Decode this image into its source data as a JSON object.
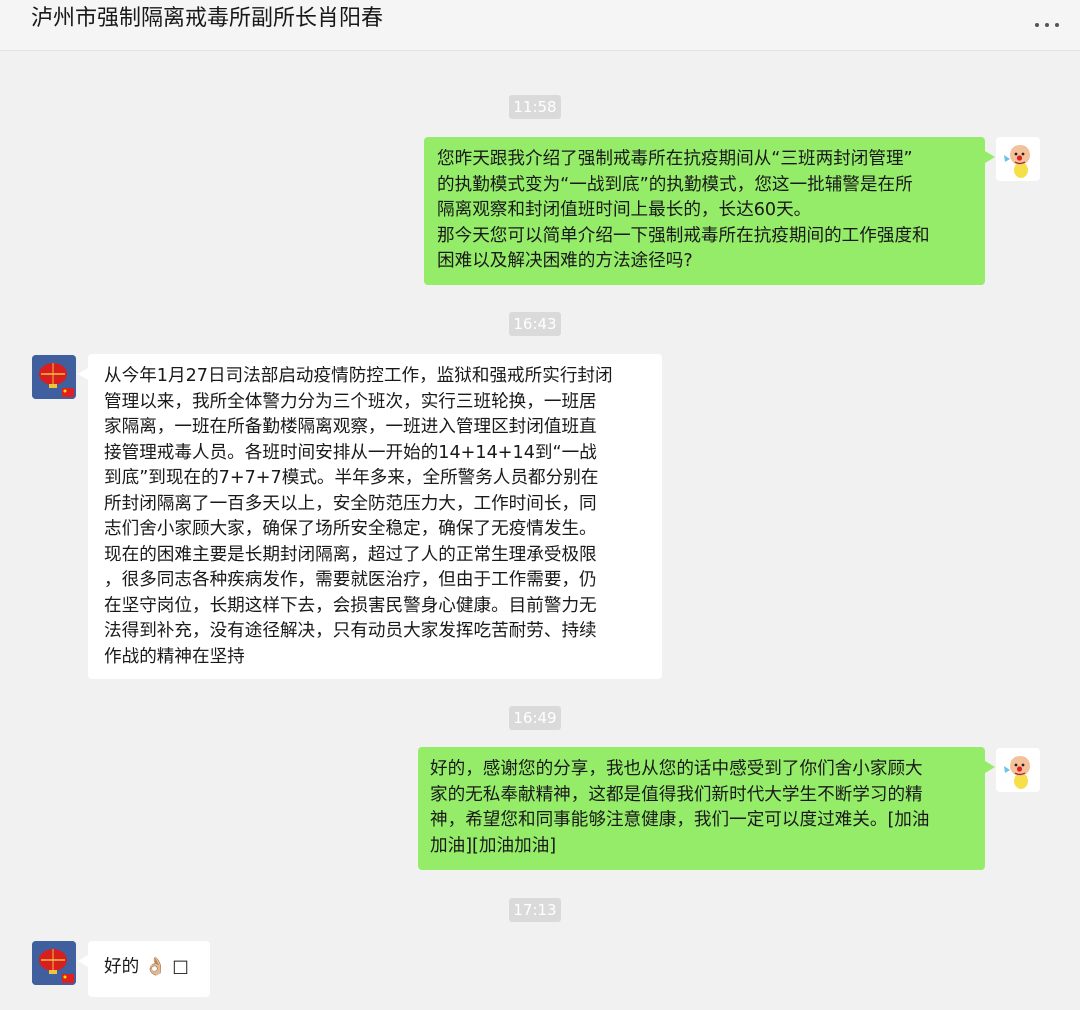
{
  "header": {
    "title": "泸州市强制隔离戒毒所副所长肖阳春",
    "more_icon": "more-icon"
  },
  "messages": [
    {
      "type": "time",
      "text": "11:58"
    },
    {
      "type": "sent",
      "text": "您昨天跟我介绍了强制戒毒所在抗疫期间从“三班两封闭管理”\n的执勤模式变为“一战到底”的执勤模式，您这一批辅警是在所\n隔离观察和封闭值班时间上最长的，长达60天。\n那今天您可以简单介绍一下强制戒毒所在抗疫期间的工作强度和\n困难以及解决困难的方法途径吗?"
    },
    {
      "type": "time",
      "text": "16:43"
    },
    {
      "type": "received",
      "text": "从今年1月27日司法部启动疫情防控工作，监狱和强戒所实行封闭\n管理以来，我所全体警力分为三个班次，实行三班轮换，一班居\n家隔离，一班在所备勤楼隔离观察，一班进入管理区封闭值班直\n接管理戒毒人员。各班时间安排从一开始的14+14+14到“一战\n到底”到现在的7+7+7模式。半年多来，全所警务人员都分别在\n所封闭隔离了一百多天以上，安全防范压力大，工作时间长，同\n志们舍小家顾大家，确保了场所安全稳定，确保了无疫情发生。\n现在的困难主要是长期封闭隔离，超过了人的正常生理承受极限\n，很多同志各种疾病发作，需要就医治疗，但由于工作需要，仍\n在坚守岗位，长期这样下去，会损害民警身心健康。目前警力无\n法得到补充，没有途径解决，只有动员大家发挥吃苦耐劳、持续\n作战的精神在坚持"
    },
    {
      "type": "time",
      "text": "16:49"
    },
    {
      "type": "sent",
      "text": "好的，感谢您的分享，我也从您的话中感受到了你们舍小家顾大\n家的无私奉献精神，这都是值得我们新时代大学生不断学习的精\n神，希望您和同事能够注意健康，我们一定可以度过难关。[加油\n加油][加油加油]"
    },
    {
      "type": "time",
      "text": "17:13"
    },
    {
      "type": "received",
      "text": "好的 👌🏼 □"
    }
  ],
  "colors": {
    "background": "#f1f1f1",
    "sent_bubble": "#95ec69",
    "received_bubble": "#ffffff",
    "time_badge": "#dadada"
  },
  "icons": {
    "my_avatar": "cartoon-clown-avatar",
    "other_avatar": "lantern-flag-avatar"
  }
}
